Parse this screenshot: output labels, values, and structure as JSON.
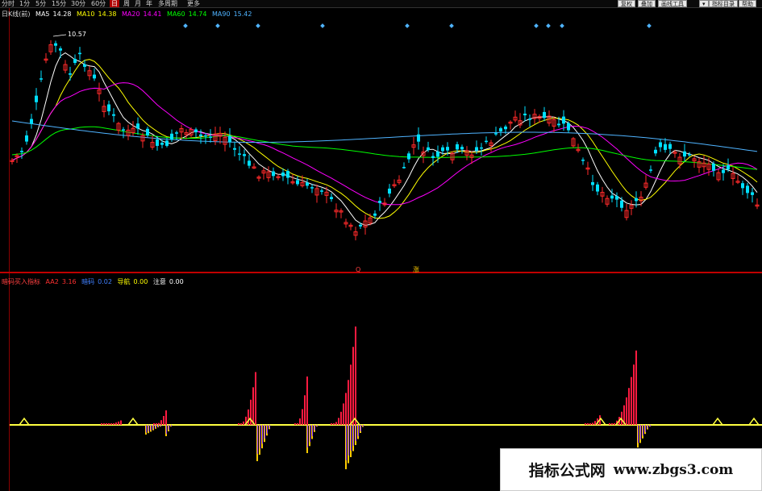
{
  "toolbar": {
    "tabs": [
      {
        "label": "分时",
        "active": false
      },
      {
        "label": "1分",
        "active": false
      },
      {
        "label": "5分",
        "active": false
      },
      {
        "label": "15分",
        "active": false
      },
      {
        "label": "30分",
        "active": false
      },
      {
        "label": "60分",
        "active": false
      },
      {
        "label": "日",
        "active": true
      },
      {
        "label": "周",
        "active": false
      },
      {
        "label": "月",
        "active": false
      },
      {
        "label": "年",
        "active": false
      },
      {
        "label": "多周期",
        "active": false
      },
      {
        "label": "更多",
        "active": false
      }
    ],
    "right_buttons": [
      "复权",
      "叠加",
      "画线工具",
      "▾",
      "指标目录",
      "帮助"
    ]
  },
  "price_legend": {
    "chart_name": "日K线(前)",
    "ma_items": [
      {
        "label": "MA5",
        "value": "14.28",
        "color": "#ffffff"
      },
      {
        "label": "MA10",
        "value": "14.38",
        "color": "#ffff00"
      },
      {
        "label": "MA20",
        "value": "14.41",
        "color": "#ff00ff"
      },
      {
        "label": "MA60",
        "value": "14.74",
        "color": "#00ff00"
      },
      {
        "label": "MA90",
        "value": "15.42",
        "color": "#4fb3ff"
      }
    ]
  },
  "price_annotations": {
    "high_label": "10.57",
    "q_label": "Q",
    "zhang_label": "涨"
  },
  "indicator_legend": {
    "name": "暗码买入指标",
    "items": [
      {
        "label": "AA2",
        "value": "3.16",
        "color": "#ff3030"
      },
      {
        "label": "暗码",
        "value": "0.02",
        "color": "#4080ff"
      },
      {
        "label": "导航",
        "value": "0.00",
        "color": "#ffff00"
      },
      {
        "label": "注意",
        "value": "0.00",
        "color": "#ffffff"
      }
    ]
  },
  "watermark": {
    "cn": "指标公式网",
    "url": "www.zbgs3.com"
  },
  "colors": {
    "up": "#ff2a2a",
    "down": "#00e0ff",
    "ma5": "#ffffff",
    "ma10": "#ffff00",
    "ma20": "#ff00ff",
    "ma60": "#00ff00",
    "ma90": "#4fb3ff",
    "bar_up": "#ff1a40",
    "bar_down": "#ffcc00",
    "nav_line": "#ffff40"
  }
}
